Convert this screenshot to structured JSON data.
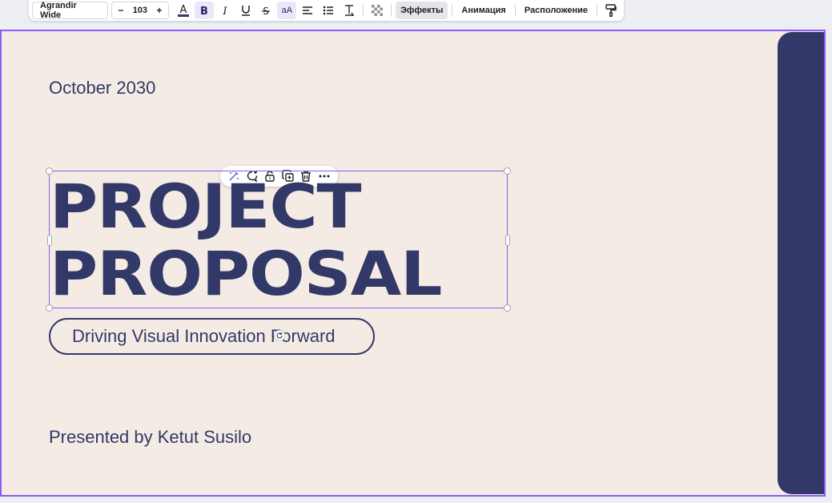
{
  "toolbar": {
    "font_family": "Agrandir Wide",
    "font_size": "103",
    "size_decrease": "−",
    "size_increase": "+",
    "case_label": "aA",
    "effects_label": "Эффекты",
    "animation_label": "Анимация",
    "position_label": "Расположение"
  },
  "slide": {
    "date": "October 2030",
    "title_line1": "PROJECT",
    "title_line2": "PROPOSAL",
    "subtitle": "Driving Visual Innovation Forward",
    "presenter": "Presented by Ketut Susilo"
  },
  "colors": {
    "brand_navy": "#323868",
    "canvas_bg": "#f4ece4",
    "selection": "#8b5cf6"
  },
  "icons": [
    "text-color-icon",
    "bold-icon",
    "italic-icon",
    "underline-icon",
    "strikethrough-icon",
    "align-left-icon",
    "list-icon",
    "line-spacing-icon",
    "transparency-icon",
    "paint-roller-icon",
    "magic-edit-icon",
    "comment-icon",
    "lock-icon",
    "duplicate-icon",
    "trash-icon",
    "more-icon",
    "rotate-icon"
  ]
}
